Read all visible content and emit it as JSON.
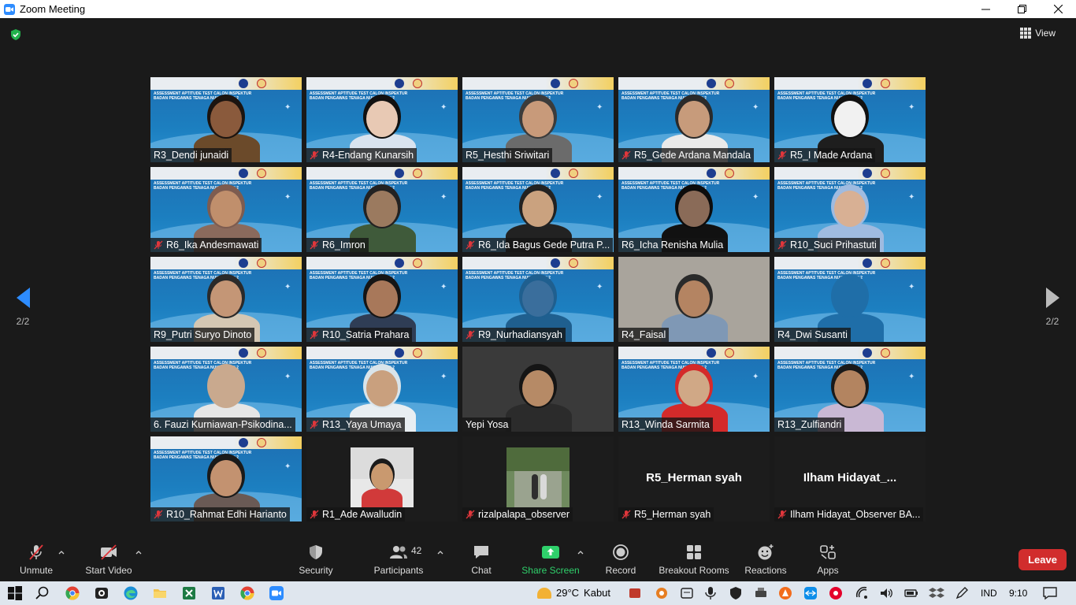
{
  "window": {
    "title": "Zoom Meeting"
  },
  "view_label": "View",
  "pagination": {
    "left": "2/2",
    "right": "2/2"
  },
  "slide": {
    "title_line1": "ASSESSMENT APTITUDE TEST CALON INSPEKTUR",
    "title_line2": "BADAN PENGAWAS TENAGA NUKLIR SESI 2"
  },
  "participants": [
    {
      "name": "R3_Dendi junaidi",
      "muted": false,
      "kind": "slide",
      "skin": "#8a5a3c",
      "shirt": "#6b4a2a",
      "hair": "#1b1410"
    },
    {
      "name": "R4-Endang Kunarsih",
      "muted": true,
      "kind": "slide",
      "skin": "#e8c9b4",
      "shirt": "#d9e3ef",
      "hair": "#111"
    },
    {
      "name": "R5_Hesthi Sriwitari",
      "muted": false,
      "kind": "slide",
      "skin": "#c89a7a",
      "shirt": "#6b6b6b",
      "hair": "#3b3b3b"
    },
    {
      "name": "R5_Gede Ardana Mandala",
      "muted": true,
      "kind": "slide",
      "skin": "#c79b7b",
      "shirt": "#eaeaea",
      "hair": "#2a2a2a"
    },
    {
      "name": "R5_I Made Ardana",
      "muted": true,
      "kind": "slide",
      "skin": "#f1f1f1",
      "shirt": "#1e1e1e",
      "hair": "#111"
    },
    {
      "name": "R6_Ika Andesmawati",
      "muted": true,
      "kind": "slide",
      "skin": "#c08f6c",
      "shirt": "#8b6a5c",
      "hair": "#7d5c50"
    },
    {
      "name": "R6_Imron",
      "muted": true,
      "kind": "slide",
      "skin": "#9b7a5f",
      "shirt": "#3f5a3a",
      "hair": "#222"
    },
    {
      "name": "R6_Ida Bagus Gede Putra P...",
      "muted": true,
      "kind": "slide",
      "skin": "#caa27f",
      "shirt": "#222",
      "hair": "#222"
    },
    {
      "name": "R6_Icha Renisha Mulia",
      "muted": false,
      "kind": "slide",
      "skin": "#8a6b58",
      "shirt": "#111",
      "hair": "#0c0c0c"
    },
    {
      "name": "R10_Suci Prihastuti",
      "muted": true,
      "kind": "slide",
      "skin": "#d8b094",
      "shirt": "#9fbbe0",
      "hair": "#9fbbe0"
    },
    {
      "name": "R9_Putri Suryo Dinoto",
      "muted": false,
      "kind": "slide",
      "skin": "#c49676",
      "shirt": "#d4c7b3",
      "hair": "#2a2a2a",
      "active": true
    },
    {
      "name": "R10_Satria Prahara",
      "muted": true,
      "kind": "slide",
      "skin": "#a8785a",
      "shirt": "#2f3d55",
      "hair": "#151515"
    },
    {
      "name": "R9_Nurhadiansyah",
      "muted": true,
      "kind": "slide",
      "skin": "#3a6e9c",
      "shirt": "#1f5f8f",
      "hair": "#1f5f8f"
    },
    {
      "name": "R4_Faisal",
      "muted": false,
      "kind": "photo",
      "skin": "#b48462",
      "shirt": "#7f98b5",
      "hair": "#2a2a2a"
    },
    {
      "name": "R4_Dwi Susanti",
      "muted": false,
      "kind": "slide",
      "skin": "#1f6ea8",
      "shirt": "#1f6ea8",
      "hair": "#1f6ea8"
    },
    {
      "name": "6. Fauzi Kurniawan-Psikodina...",
      "muted": false,
      "kind": "slide",
      "skin": "#c9a98e",
      "shirt": "#e6e6e6",
      "hair": "#c9a98e"
    },
    {
      "name": "R13_Yaya Umaya",
      "muted": true,
      "kind": "slide",
      "skin": "#c9a07e",
      "shirt": "#e8eef2",
      "hair": "#d9e4ea"
    },
    {
      "name": "Yepi Yosa",
      "muted": false,
      "kind": "dark",
      "skin": "#b68a66",
      "shirt": "#2b2b2b",
      "hair": "#151515"
    },
    {
      "name": "R13_Winda Sarmita",
      "muted": false,
      "kind": "slide",
      "skin": "#d0a886",
      "shirt": "#d42a2a",
      "hair": "#d42a2a"
    },
    {
      "name": "R13_Zulfiandri",
      "muted": false,
      "kind": "slide",
      "skin": "#b38460",
      "shirt": "#c9b8d4",
      "hair": "#1a1a1a"
    },
    {
      "name": "R10_Rahmat Edhi Harianto",
      "muted": true,
      "kind": "slide",
      "skin": "#c39270",
      "shirt": "#6a5a55",
      "hair": "#1a1a1a"
    },
    {
      "name": "R1_Ade Awalludin",
      "muted": true,
      "kind": "thumb",
      "skin": "#c9996f",
      "shirt": "#d13a3a",
      "hair": "#1a1a1a"
    },
    {
      "name": "rizalpalapa_observer",
      "muted": true,
      "kind": "thumb2",
      "skin": "#5d7a4a",
      "shirt": "#3c5a30",
      "hair": "#2e2e2e"
    },
    {
      "name": "R5_Herman syah",
      "muted": true,
      "kind": "empty",
      "bigname": "R5_Herman syah"
    },
    {
      "name": "Ilham Hidayat_Observer BA...",
      "muted": true,
      "kind": "empty",
      "bigname": "Ilham  Hidayat_..."
    }
  ],
  "toolbar": {
    "unmute": "Unmute",
    "start_video": "Start Video",
    "security": "Security",
    "participants": "Participants",
    "participants_count": "42",
    "chat": "Chat",
    "share_screen": "Share Screen",
    "record": "Record",
    "breakout_rooms": "Breakout Rooms",
    "reactions": "Reactions",
    "apps": "Apps",
    "leave": "Leave"
  },
  "taskbar": {
    "temperature": "29°C",
    "weather": "Kabut",
    "language": "IND",
    "time": "9:10"
  },
  "colors": {
    "accent": "#2d8cff",
    "leave": "#d12d2d",
    "share": "#2fd06b",
    "active_speaker": "#d9f02c",
    "muted": "#e0363b"
  }
}
